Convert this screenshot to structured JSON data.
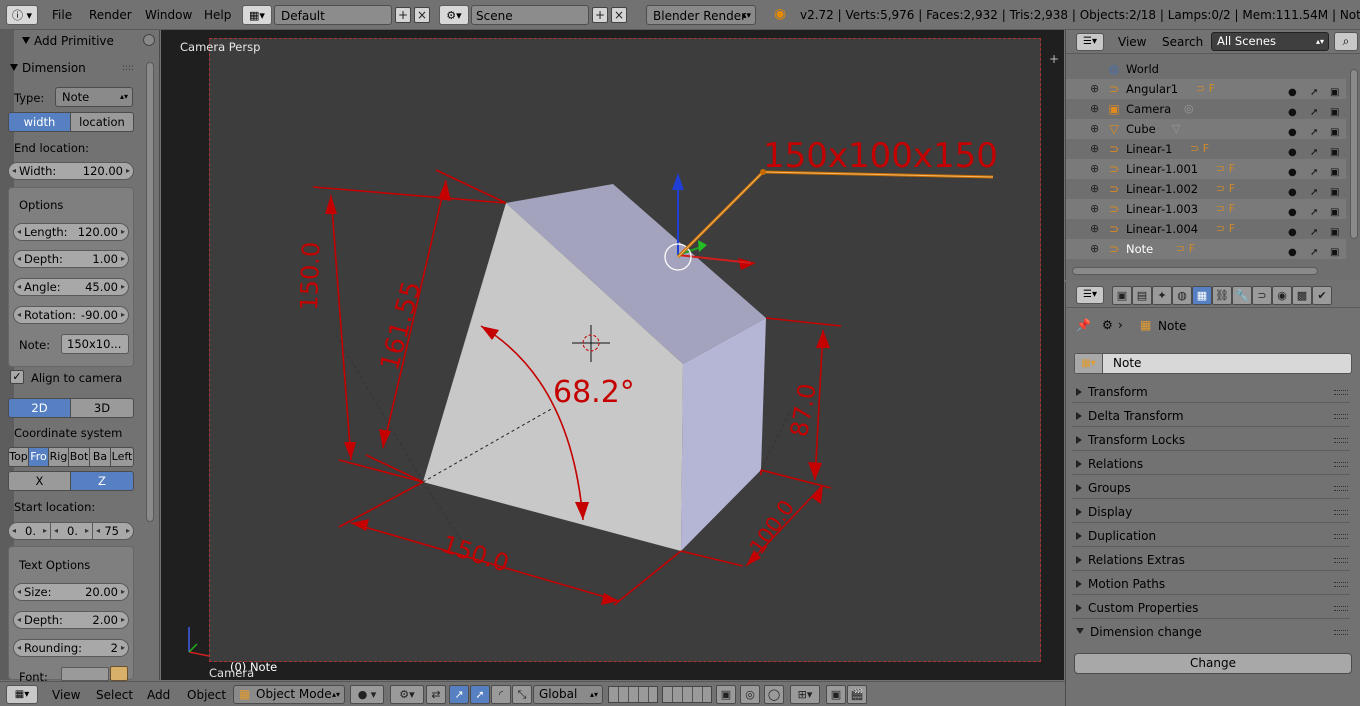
{
  "topbar": {
    "menus": [
      "File",
      "Render",
      "Window",
      "Help"
    ],
    "layout": "Default",
    "scene": "Scene",
    "engine": "Blender Render",
    "stats": "v2.72 | Verts:5,976 | Faces:2,932 | Tris:2,938 | Objects:2/18 | Lamps:0/2 | Mem:111.54M | Note"
  },
  "toolshelf": {
    "add_primitive": "Add Primitive",
    "dimension": "Dimension",
    "type_label": "Type:",
    "type_value": "Note",
    "width_btn": "width",
    "location_btn": "location",
    "end_location": "End location:",
    "width_label": "Width:",
    "width_value": "120.00",
    "options": "Options",
    "length_label": "Length:",
    "length_value": "120.00",
    "depth_label": "Depth:",
    "depth_value": "1.00",
    "angle_label": "Angle:",
    "angle_value": "45.00",
    "rotation_label": "Rotation:",
    "rotation_value": "-90.00",
    "note_label": "Note:",
    "note_value": "150x10...",
    "align_camera": "Align to camera",
    "mode_2d": "2D",
    "mode_3d": "3D",
    "coord_system": "Coordinate system",
    "views": [
      "Top",
      "Fro",
      "Rig",
      "Bot",
      "Ba",
      "Left"
    ],
    "axis_x": "X",
    "axis_z": "Z",
    "start_location": "Start location:",
    "start_values": [
      "0.",
      "0.",
      "75"
    ],
    "text_options": "Text Options",
    "size_label": "Size:",
    "size_value": "20.00",
    "tdepth_label": "Depth:",
    "tdepth_value": "2.00",
    "rounding_label": "Rounding:",
    "rounding_value": "2",
    "font_label": "Font:"
  },
  "viewport": {
    "title": "Camera Persp",
    "object_label": "(0) Note",
    "camera_label": "Camera",
    "note_text": "150x100x150",
    "dim_1550_left": "150.0",
    "dim_16155": "161.55",
    "dim_angle": "68.2°",
    "dim_870": "87.0",
    "dim_1000": "100.0",
    "dim_1500_bottom": "150.0",
    "colors": {
      "dim_red": "#c40000",
      "cube_front": "#c6c6c6",
      "cube_top": "#a3a3bd",
      "cube_side": "#b5b5d6"
    }
  },
  "outliner": {
    "view": "View",
    "search": "Search",
    "scenes": "All Scenes",
    "items": [
      {
        "name": "World",
        "icon": "world-icon"
      },
      {
        "name": "Angular1",
        "icon": "curve-icon"
      },
      {
        "name": "Camera",
        "icon": "camera-icon"
      },
      {
        "name": "Cube",
        "icon": "mesh-icon"
      },
      {
        "name": "Linear-1",
        "icon": "curve-icon"
      },
      {
        "name": "Linear-1.001",
        "icon": "curve-icon"
      },
      {
        "name": "Linear-1.002",
        "icon": "curve-icon"
      },
      {
        "name": "Linear-1.003",
        "icon": "curve-icon"
      },
      {
        "name": "Linear-1.004",
        "icon": "curve-icon"
      },
      {
        "name": "Note",
        "icon": "curve-icon"
      }
    ]
  },
  "properties": {
    "breadcrumb": "Note",
    "object_name": "Note",
    "panels": [
      "Transform",
      "Delta Transform",
      "Transform Locks",
      "Relations",
      "Groups",
      "Display",
      "Duplication",
      "Relations Extras",
      "Motion Paths",
      "Custom Properties"
    ],
    "open_panel": "Dimension change",
    "change_btn": "Change"
  },
  "bottombar": {
    "view": "View",
    "select": "Select",
    "add": "Add",
    "object": "Object",
    "mode": "Object Mode",
    "orientation": "Global"
  }
}
